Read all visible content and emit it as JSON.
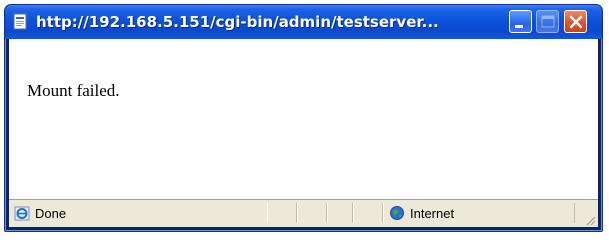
{
  "window": {
    "title": "http://192.168.5.151/cgi-bin/admin/testserver..."
  },
  "content": {
    "message": "Mount failed."
  },
  "statusbar": {
    "status_text": "Done",
    "zone_text": "Internet"
  },
  "icons": {
    "title_icon": "ie-page-icon",
    "minimize": "minimize-icon",
    "maximize": "maximize-icon",
    "close": "close-icon",
    "status": "ie-done-icon",
    "zone": "internet-zone-icon"
  },
  "colors": {
    "titlebar": "#0a52dc",
    "close_button": "#e0542c",
    "statusbar": "#ece9d8"
  }
}
